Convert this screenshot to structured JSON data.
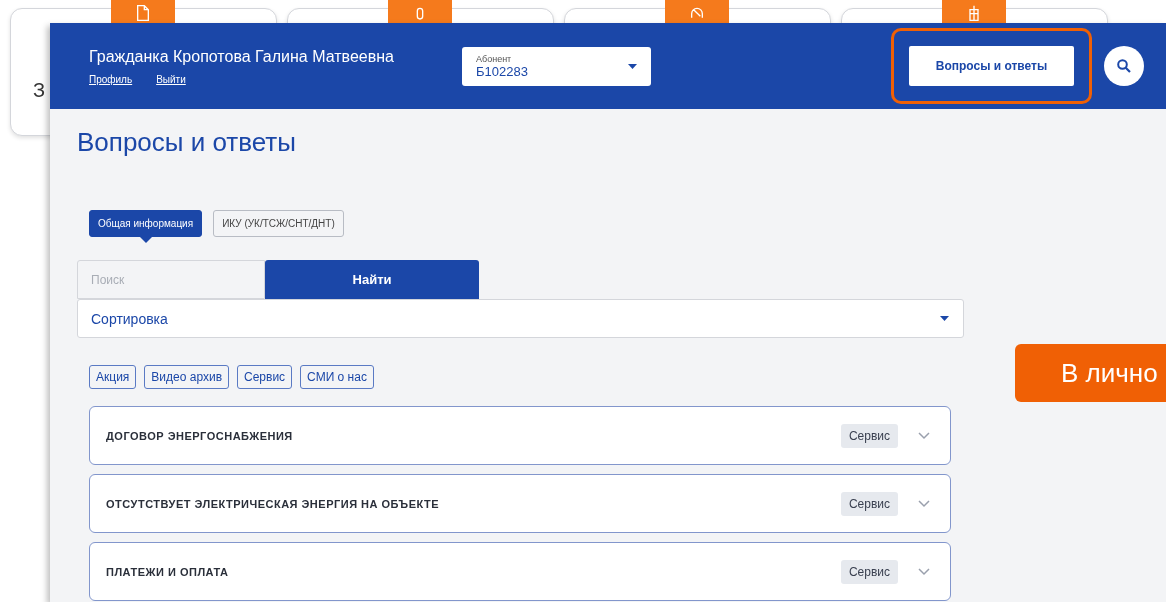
{
  "background_page": {
    "card_text": "З"
  },
  "header": {
    "user_name": "Гражданка Кропотова Галина Матвеевна",
    "links": [
      "Профиль",
      "Выйти"
    ],
    "account_select": {
      "label": "Абонент",
      "value": "Б102283"
    },
    "faq_button": "Вопросы и ответы",
    "faq_button_highlighted": true
  },
  "page_title": "Вопросы и ответы",
  "tabs": [
    {
      "label": "Общая информация",
      "selected": true
    },
    {
      "label": "ИКУ (УК/ТСЖ/СНТ/ДНТ)",
      "selected": false
    }
  ],
  "search": {
    "placeholder": "Поиск",
    "button": "Найти"
  },
  "sort_select": {
    "value": "Сортировка"
  },
  "tags": [
    "Акция",
    "Видео архив",
    "Сервис",
    "СМИ о нас"
  ],
  "questions": [
    {
      "title": "ДОГОВОР ЭНЕРГОСНАБЖЕНИЯ",
      "tag": "Сервис",
      "expanded": false
    },
    {
      "title": "ОТСУТСТВУЕТ ЭЛЕКТРИЧЕСКАЯ ЭНЕРГИЯ НА ОБЪЕКТЕ",
      "tag": "Сервис",
      "expanded": false
    },
    {
      "title": "ПЛАТЕЖИ И ОПЛАТА",
      "tag": "Сервис",
      "expanded": false
    }
  ],
  "cabinet_button": "В лично"
}
